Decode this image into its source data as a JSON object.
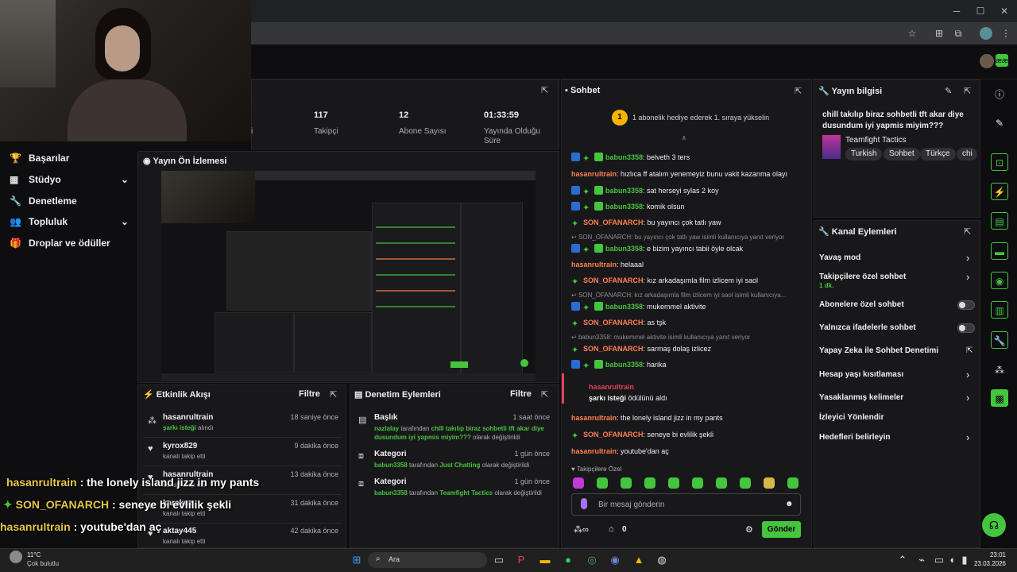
{
  "browser": {
    "minimize": "─",
    "maximize": "☐",
    "close": "✕"
  },
  "nav": {
    "items": [
      {
        "label": "Başarılar",
        "icon": "trophy-icon"
      },
      {
        "label": "Stüdyo",
        "icon": "studio-icon"
      },
      {
        "label": "Denetleme",
        "icon": "wrench-icon"
      },
      {
        "label": "Topluluk",
        "icon": "community-icon"
      },
      {
        "label": "Droplar ve ödüller",
        "icon": "drops-icon"
      }
    ]
  },
  "stats": {
    "partial_label": "i",
    "items": [
      {
        "value": "117",
        "label": "Takipçi"
      },
      {
        "value": "12",
        "label": "Abone Sayısı"
      },
      {
        "value": "01:33:59",
        "label": "Yayında Olduğu Süre"
      }
    ]
  },
  "preview": {
    "title": "Yayın Ön İzlemesi"
  },
  "activity": {
    "title": "Etkinlik Akışı",
    "filter": "Filtre",
    "items": [
      {
        "name": "hasanrultrain",
        "sub_accent": "şarkı isteği",
        "sub": " alındı",
        "time": "18 saniye önce",
        "icon": "channel-points-icon"
      },
      {
        "name": "kyrox829",
        "sub": "kanalı takip etti",
        "time": "9 dakika önce",
        "icon": "heart-icon"
      },
      {
        "name": "hasanrultrain",
        "sub": "kanalı takip etti",
        "time": "13 dakika önce",
        "icon": "heart-icon"
      },
      {
        "name": "karakuz",
        "sub": "kanalı takip etti",
        "time": "31 dakika önce",
        "icon": "heart-icon"
      },
      {
        "name": "aktay445",
        "sub": "kanalı takip etti",
        "time": "42 dakika önce",
        "icon": "heart-icon"
      }
    ]
  },
  "moderation": {
    "title": "Denetim Eylemleri",
    "filter": "Filtre",
    "items": [
      {
        "title": "Başlık",
        "time": "1 saat önce",
        "user": "nazlalay",
        "middle": " tarafından ",
        "value": "chill takılıp biraz sohbetli tft akar diye dusundum iyi yapmis miyim???",
        "end": " olarak değiştirildi"
      },
      {
        "title": "Kategori",
        "time": "1 gün önce",
        "user": "babun3358",
        "middle": " tarafından ",
        "value": "Just Chatting",
        "end": " olarak değiştirildi"
      },
      {
        "title": "Kategori",
        "time": "1 gün önce",
        "user": "babun3358",
        "middle": " tarafından ",
        "value": "Teamfight Tactics",
        "end": " olarak değiştirildi"
      }
    ]
  },
  "chat": {
    "title": "Sohbet",
    "pinned_rank": "1",
    "pinned_text": "1 abonelik hediye ederek 1. sıraya yükselin",
    "messages": [
      {
        "user": "babun3358",
        "text": ": belveth 3 ters",
        "style": "green",
        "badges": true
      },
      {
        "user": "hasanrultrain",
        "text": ": hızlıca ff atalım yenemeyiz bunu vakit kazanma olayı",
        "style": "orange",
        "badges": false
      },
      {
        "user": "babun3358",
        "text": ": sat herseyi sylas 2 koy",
        "style": "green",
        "badges": true
      },
      {
        "user": "babun3358",
        "text": ": komik olsun",
        "style": "green",
        "badges": true
      },
      {
        "user": "SON_OFANARCH",
        "text": ": bu yayıncı çok tatlı yaw",
        "style": "orange",
        "badges": false,
        "gem": true
      },
      {
        "reply": "SON_OFANARCH: bu yayıncı çok tatlı yaw isimli kullanıcıya yanıt veriyor",
        "user": "babun3358",
        "text": ": e bizim yayıncı tabii öyle olcak",
        "style": "green",
        "badges": true
      },
      {
        "user": "hasanrultrain",
        "text": ": helaaal",
        "style": "orange",
        "badges": false
      },
      {
        "user": "SON_OFANARCH",
        "text": ": kız arkadaşımla film izlicem iyi saol",
        "style": "orange",
        "badges": false,
        "gem": true
      },
      {
        "reply": "SON_OFANARCH: kız arkadaşımla film izlicem iyi saol isimli kullanıcıya...",
        "user": "babun3358",
        "text": ": mukemmel aktivite",
        "style": "green",
        "badges": true
      },
      {
        "user": "SON_OFANARCH",
        "text": ": as tşk",
        "style": "orange",
        "badges": false,
        "gem": true
      },
      {
        "reply": "babun3358: mukemmel aktivite isimli kullanıcıya yanıt veriyor",
        "user": "SON_OFANARCH",
        "text": ": sarmaş dolaş izlicez",
        "style": "orange",
        "badges": false,
        "gem": true
      },
      {
        "user": "babun3358",
        "text": ": harika",
        "style": "green",
        "badges": true
      }
    ],
    "redeem_user": "hasanrultrain",
    "redeem_accent": "şarkı isteği",
    "redeem_text": " ödülünü aldı",
    "after": [
      {
        "user": "hasanrultrain",
        "text": ": the lonely island jizz in my pants",
        "style": "orange",
        "gem": false
      },
      {
        "user": "SON_OFANARCH",
        "text": ": seneye bi evlilik şekli",
        "style": "orange",
        "gem": true
      },
      {
        "user": "hasanrultrain",
        "text": ": youtube'dan aç",
        "style": "orange",
        "gem": false
      }
    ],
    "followers_only": "Takipçilere Özel",
    "input_placeholder": "Bir mesaj gönderin",
    "points": "0",
    "send": "Gönder"
  },
  "stream_info": {
    "title": "Yayın bilgisi",
    "stream_title": "chill takılıp biraz sohbetli tft akar diye dusundum iyi yapmis miyim???",
    "game": "Teamfight Tactics",
    "tags": [
      "Turkish",
      "Sohbet",
      "Türkçe",
      "chi"
    ]
  },
  "channel_actions": {
    "title": "Kanal Eylemleri",
    "rows": [
      {
        "label": "Yavaş mod",
        "kind": "chevron"
      },
      {
        "label": "Takipçilere özel sohbet",
        "sub": "1 dk.",
        "kind": "chevron"
      },
      {
        "label": "Abonelere özel sohbet",
        "kind": "toggle"
      },
      {
        "label": "Yalnızca ifadelerle sohbet",
        "kind": "toggle"
      },
      {
        "label": "Yapay Zeka ile Sohbet Denetimi",
        "kind": "external"
      },
      {
        "label": "Hesap yaşı kısıtlaması",
        "kind": "chevron"
      },
      {
        "label": "Yasaklanmış kelimeler",
        "kind": "chevron"
      },
      {
        "label": "İzleyici Yönlendir",
        "kind": "none"
      },
      {
        "label": "Hedefleri belirleyin",
        "kind": "chevron"
      }
    ]
  },
  "overlay": [
    {
      "user": "hasanrultrain",
      "text": " : the lonely island jizz in my pants",
      "gem": false
    },
    {
      "user": "SON_OFANARCH",
      "text": " : seneye bi evlilik şekli",
      "gem": true
    },
    {
      "user": "hasanrultrain",
      "text": " : youtube'dan aç",
      "gem": false
    }
  ],
  "taskbar": {
    "weather_temp": "11°C",
    "weather_desc": "Çok bulutlu",
    "search": "Ara",
    "time": "23:01",
    "date": "23.03.2026"
  },
  "colors": {
    "accent": "#45c43d",
    "bg": "#0e0e10",
    "panel": "#18181b"
  }
}
